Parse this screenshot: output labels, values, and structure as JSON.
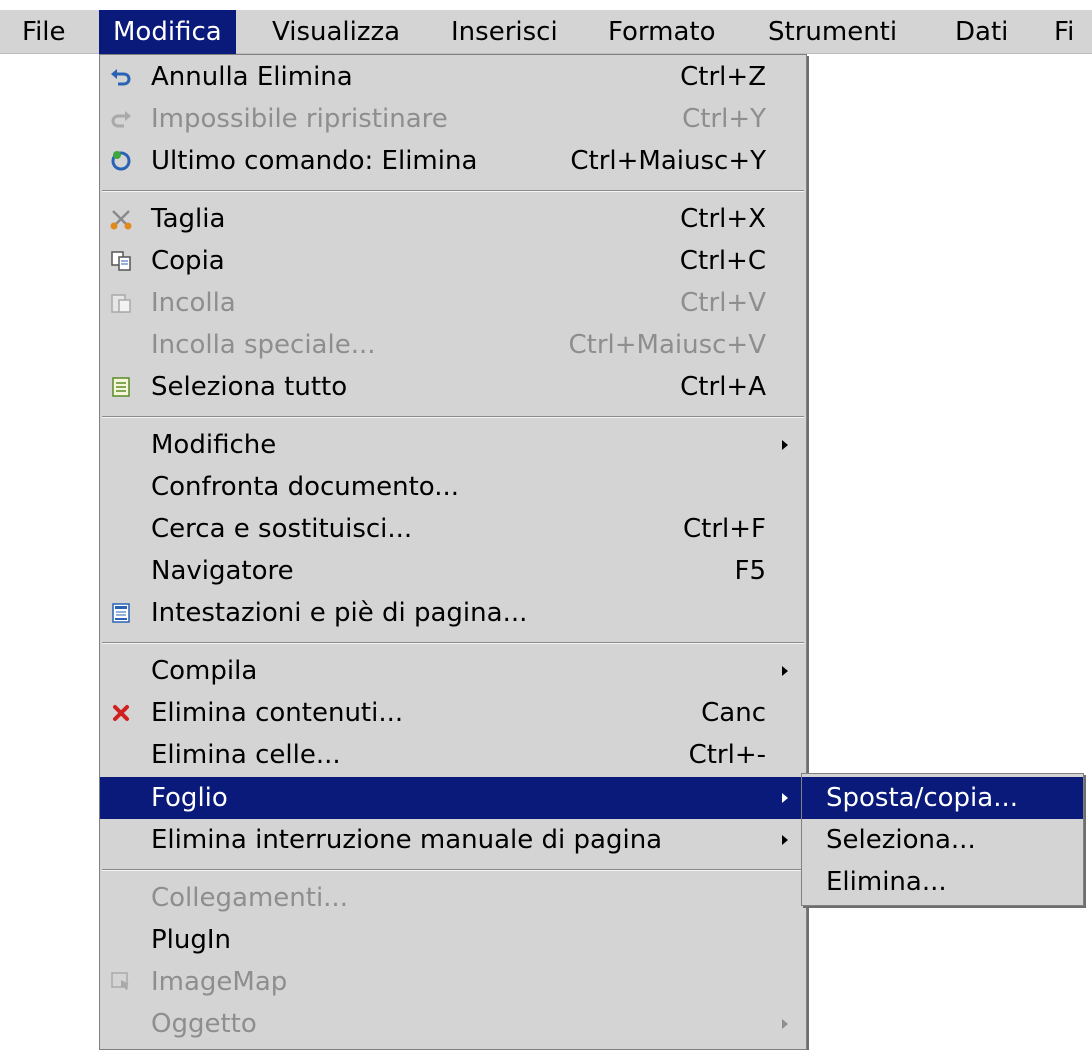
{
  "menubar": {
    "items": [
      "File",
      "Modifica",
      "Visualizza",
      "Inserisci",
      "Formato",
      "Strumenti",
      "Dati",
      "Fi"
    ]
  },
  "edit_menu": {
    "items": [
      {
        "label": "Annulla Elimina",
        "shortcut": "Ctrl+Z",
        "icon": "undo-icon"
      },
      {
        "label": "Impossibile ripristinare",
        "shortcut": "Ctrl+Y",
        "icon": "redo-icon",
        "disabled": true
      },
      {
        "label": "Ultimo comando: Elimina",
        "shortcut": "Ctrl+Maiusc+Y",
        "icon": "repeat-icon"
      },
      {
        "label": "Taglia",
        "shortcut": "Ctrl+X",
        "icon": "scissors-icon"
      },
      {
        "label": "Copia",
        "shortcut": "Ctrl+C",
        "icon": "copy-icon"
      },
      {
        "label": "Incolla",
        "shortcut": "Ctrl+V",
        "icon": "paste-icon",
        "disabled": true
      },
      {
        "label": "Incolla speciale...",
        "shortcut": "Ctrl+Maiusc+V",
        "disabled": true
      },
      {
        "label": "Seleziona tutto",
        "shortcut": "Ctrl+A",
        "icon": "select-all-icon"
      },
      {
        "label": "Modifiche",
        "submenu": true
      },
      {
        "label": "Confronta documento..."
      },
      {
        "label": "Cerca e sostituisci...",
        "shortcut": "Ctrl+F"
      },
      {
        "label": "Navigatore",
        "shortcut": "F5"
      },
      {
        "label": "Intestazioni e piè di pagina...",
        "icon": "header-footer-icon"
      },
      {
        "label": "Compila",
        "submenu": true
      },
      {
        "label": "Elimina contenuti...",
        "shortcut": "Canc",
        "icon": "delete-x-icon"
      },
      {
        "label": "Elimina celle...",
        "shortcut": "Ctrl+-"
      },
      {
        "label": "Foglio",
        "submenu": true,
        "highlighted": true
      },
      {
        "label": "Elimina interruzione manuale di pagina",
        "submenu": true
      },
      {
        "label": "Collegamenti...",
        "disabled": true
      },
      {
        "label": "PlugIn"
      },
      {
        "label": "ImageMap",
        "icon": "imagemap-icon",
        "disabled": true
      },
      {
        "label": "Oggetto",
        "submenu": true,
        "disabled": true
      }
    ]
  },
  "sheet_submenu": {
    "items": [
      {
        "label": "Sposta/copia...",
        "highlighted": true
      },
      {
        "label": "Seleziona..."
      },
      {
        "label": "Elimina..."
      }
    ]
  },
  "colors": {
    "menu_bg": "#d4d4d4",
    "highlight": "#0a1a7a",
    "disabled_text": "#8e8e8e"
  }
}
